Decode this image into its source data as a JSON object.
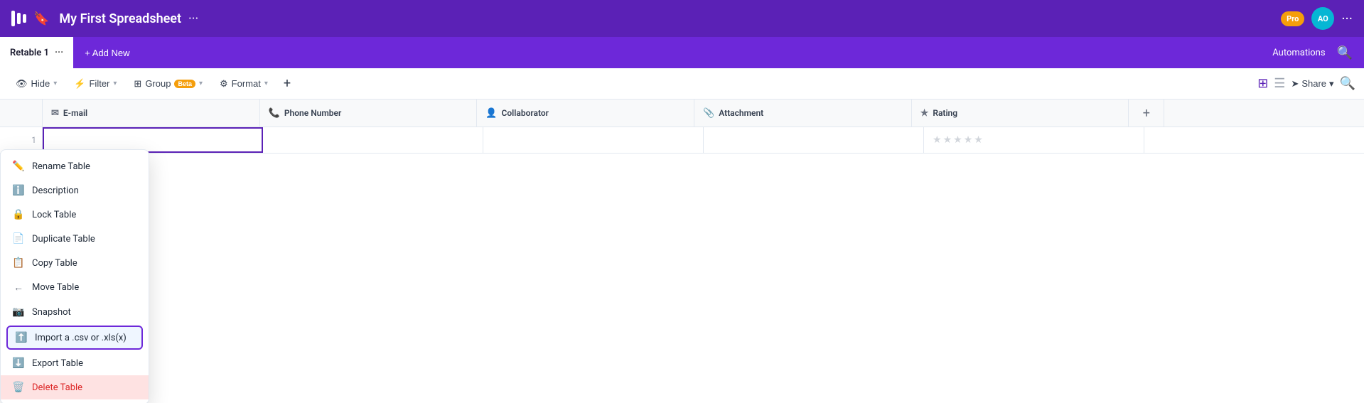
{
  "app": {
    "title": "My First Spreadsheet",
    "dots": "···",
    "pro_badge": "Pro",
    "avatar_initials": "AO",
    "more_dots": "···"
  },
  "tab_bar": {
    "tab_name": "Retable 1",
    "tab_dots": "···",
    "add_new": "+ Add New",
    "automations": "Automations"
  },
  "toolbar": {
    "hide_label": "Hide",
    "filter_label": "Filter",
    "group_label": "Group",
    "group_beta": "Beta",
    "format_label": "Format",
    "share_label": "Share"
  },
  "columns": [
    {
      "icon": "✉",
      "label": "E-mail"
    },
    {
      "icon": "📞",
      "label": "Phone Number"
    },
    {
      "icon": "👤",
      "label": "Collaborator"
    },
    {
      "icon": "📎",
      "label": "Attachment"
    },
    {
      "icon": "★",
      "label": "Rating"
    }
  ],
  "context_menu": {
    "items": [
      {
        "icon": "✏️",
        "label": "Rename Table",
        "highlighted": false,
        "active": false
      },
      {
        "icon": "ℹ️",
        "label": "Description",
        "highlighted": false,
        "active": false
      },
      {
        "icon": "🔒",
        "label": "Lock Table",
        "highlighted": false,
        "active": false
      },
      {
        "icon": "📄",
        "label": "Duplicate Table",
        "highlighted": false,
        "active": false
      },
      {
        "icon": "📋",
        "label": "Copy Table",
        "highlighted": false,
        "active": false
      },
      {
        "icon": "←",
        "label": "Move Table",
        "highlighted": false,
        "active": false
      },
      {
        "icon": "📷",
        "label": "Snapshot",
        "highlighted": false,
        "active": false
      },
      {
        "icon": "⬆️",
        "label": "Import a .csv or .xls(x)",
        "highlighted": false,
        "active": true,
        "import": true
      },
      {
        "icon": "⬇️",
        "label": "Export Table",
        "highlighted": false,
        "active": false
      },
      {
        "icon": "🗑️",
        "label": "Delete Table",
        "highlighted": true,
        "active": false
      }
    ]
  }
}
